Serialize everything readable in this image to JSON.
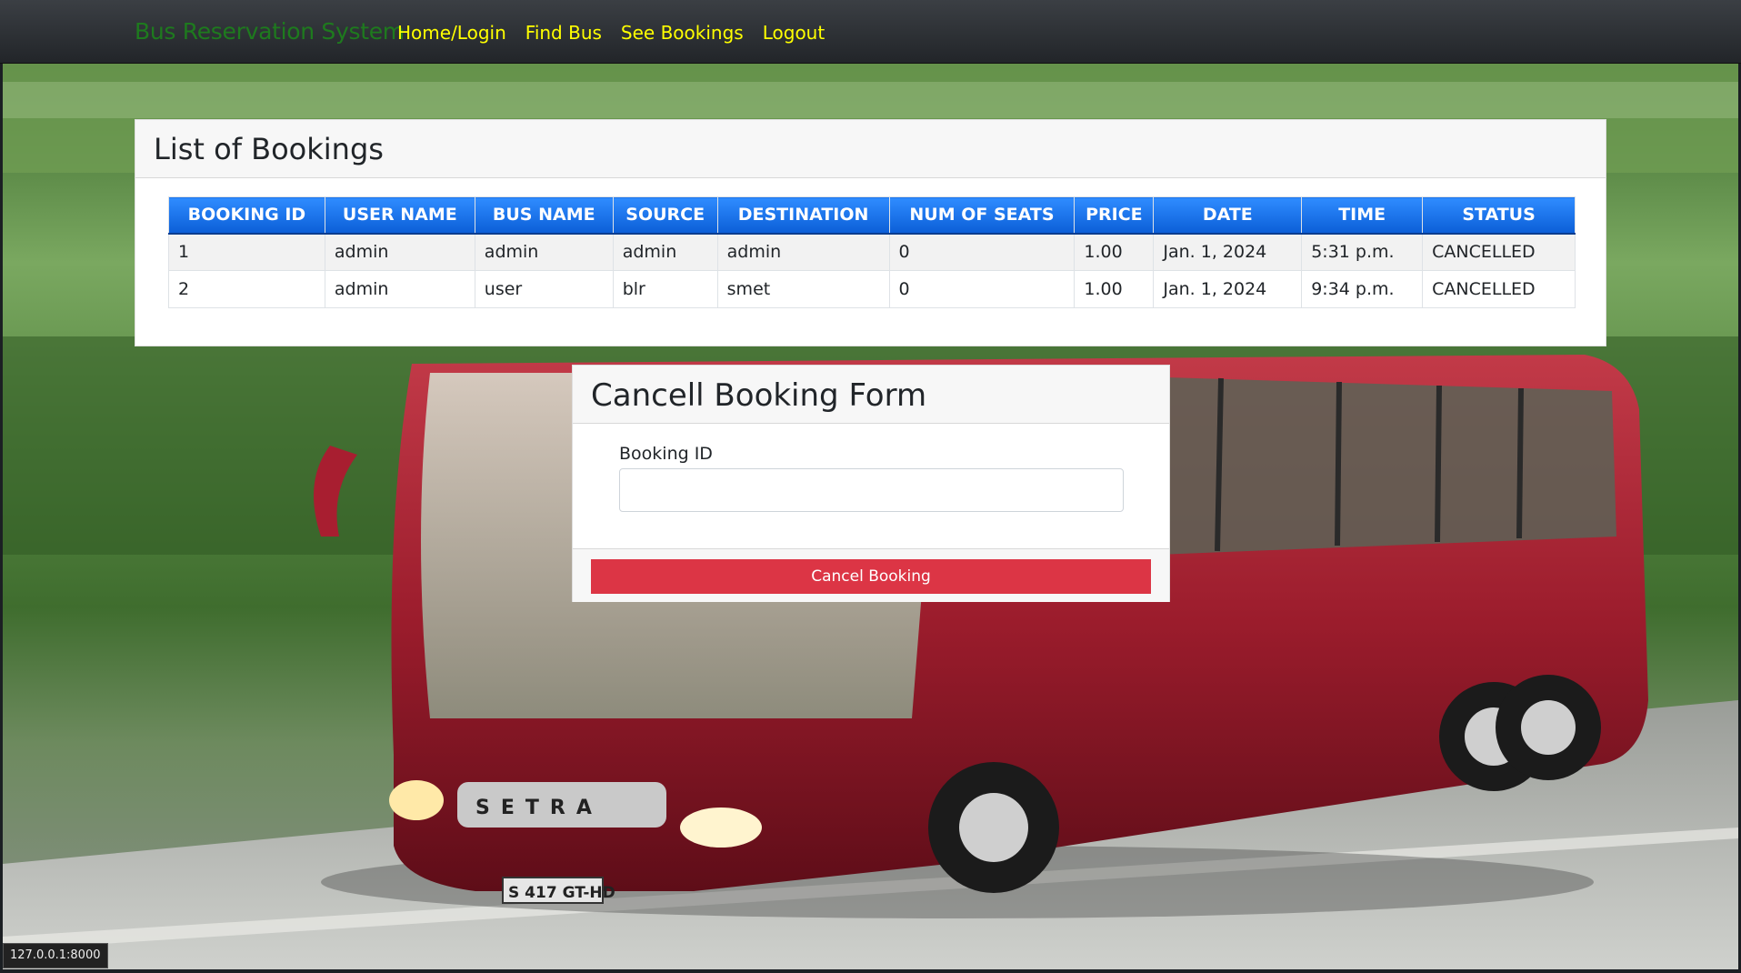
{
  "navbar": {
    "brand": "Bus Reservation System",
    "links": [
      {
        "label": "Home/Login"
      },
      {
        "label": "Find Bus"
      },
      {
        "label": "See Bookings"
      },
      {
        "label": "Logout"
      }
    ]
  },
  "bookings": {
    "title": "List of Bookings",
    "columns": [
      "BOOKING ID",
      "USER NAME",
      "BUS NAME",
      "SOURCE",
      "DESTINATION",
      "NUM OF SEATS",
      "PRICE",
      "DATE",
      "TIME",
      "STATUS"
    ],
    "rows": [
      [
        "1",
        "admin",
        "admin",
        "admin",
        "admin",
        "0",
        "1.00",
        "Jan. 1, 2024",
        "5:31 p.m.",
        "CANCELLED"
      ],
      [
        "2",
        "admin",
        "user",
        "blr",
        "smet",
        "0",
        "1.00",
        "Jan. 1, 2024",
        "9:34 p.m.",
        "CANCELLED"
      ]
    ]
  },
  "cancel_form": {
    "title": "Cancell Booking Form",
    "field_label": "Booking ID",
    "field_value": "",
    "button_label": "Cancel Booking"
  },
  "bus": {
    "brand_plate": "SETRA",
    "license_plate": "S 417 GT-HD"
  },
  "status_bar": {
    "url": "127.0.0.1:8000"
  },
  "colors": {
    "brand": "#1e7a1e",
    "nav_link": "#ffff00",
    "table_header_top": "#2f8cff",
    "table_header_bottom": "#0b5ed7",
    "button": "#dc3545",
    "bus_body": "#9b1c2c"
  }
}
